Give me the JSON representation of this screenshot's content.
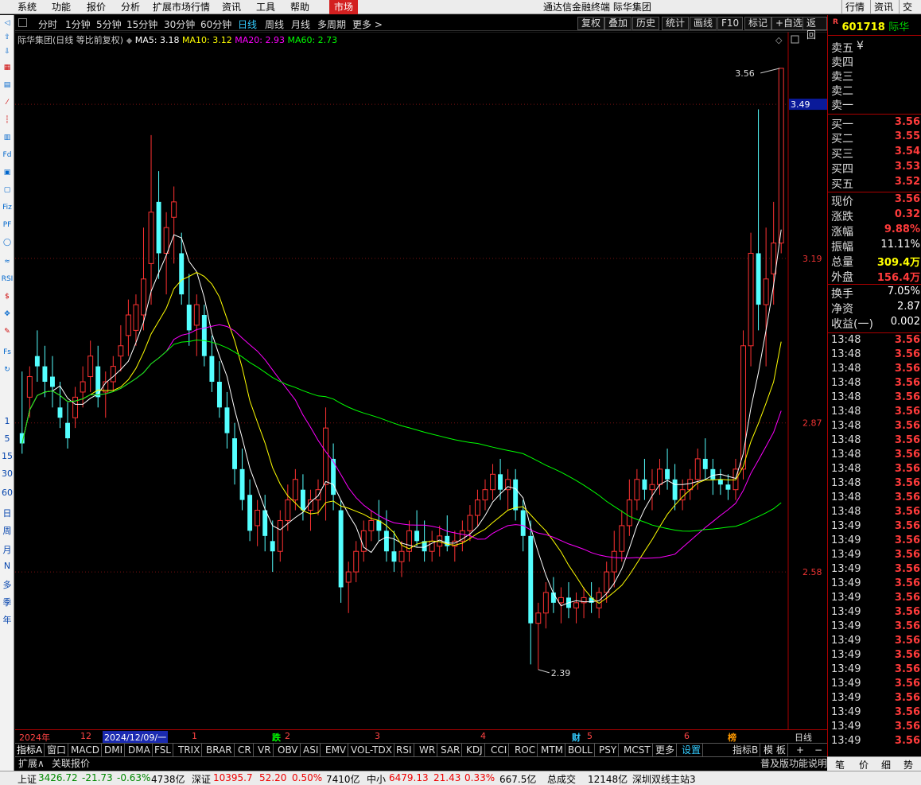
{
  "menu": {
    "items": [
      "系统",
      "功能",
      "报价",
      "分析",
      "扩展市场行情",
      "资讯",
      "工具",
      "帮助"
    ],
    "active": "市场",
    "window_title": "通达信金融终端 际华集团",
    "right": [
      "行情",
      "资讯",
      "交易"
    ]
  },
  "left_toolbar": {
    "periods": [
      "1",
      "5",
      "15",
      "30",
      "60",
      "日",
      "周",
      "月",
      "N",
      "多",
      "季",
      "年"
    ]
  },
  "periods": {
    "items": [
      "分时",
      "1分钟",
      "5分钟",
      "15分钟",
      "30分钟",
      "60分钟",
      "日线",
      "周线",
      "月线",
      "多周期",
      "更多 >"
    ],
    "selected": "日线",
    "buttons": [
      "复权",
      "叠加",
      "历史",
      "统计",
      "画线",
      "F10",
      "标记",
      "+自选",
      "返回"
    ]
  },
  "legend": {
    "title": "际华集团(日线 等比前复权)",
    "ma5": "MA5: 3.18",
    "ma10": "MA10: 3.12",
    "ma20": "MA20: 2.93",
    "ma60": "MA60: 2.73"
  },
  "chart_data": {
    "type": "candlestick",
    "ylim": [
      2.3,
      3.6
    ],
    "y_ticks": [
      "3.19",
      "2.87",
      "2.58"
    ],
    "current_price_label": "3.49",
    "high_label": "3.56",
    "low_label": "2.39",
    "x_labels": [
      "2024年",
      "12",
      "2024/12/09/一",
      "1",
      "2",
      "3",
      "4",
      "5",
      "6",
      "日线"
    ],
    "event_markers": [
      "跌",
      "财",
      "榜"
    ],
    "ma_colors": {
      "ma5": "#ffffff",
      "ma10": "#ffff00",
      "ma20": "#ff00ff",
      "ma60": "#00ff00"
    },
    "candles": [
      [
        2.85,
        2.97,
        2.81,
        2.83
      ],
      [
        2.92,
        2.98,
        2.88,
        2.96
      ],
      [
        3.0,
        3.05,
        2.95,
        2.98
      ],
      [
        2.98,
        3.02,
        2.92,
        2.95
      ],
      [
        2.96,
        3.0,
        2.9,
        2.94
      ],
      [
        2.9,
        2.95,
        2.86,
        2.88
      ],
      [
        2.87,
        2.91,
        2.82,
        2.84
      ],
      [
        2.88,
        2.94,
        2.86,
        2.92
      ],
      [
        2.93,
        2.98,
        2.9,
        2.95
      ],
      [
        2.96,
        3.03,
        2.93,
        3.0
      ],
      [
        2.98,
        3.02,
        2.9,
        2.92
      ],
      [
        2.93,
        2.97,
        2.88,
        2.95
      ],
      [
        2.95,
        3.0,
        2.93,
        2.98
      ],
      [
        3.0,
        3.06,
        2.97,
        3.02
      ],
      [
        3.04,
        3.11,
        3.0,
        3.08
      ],
      [
        3.05,
        3.12,
        3.02,
        3.1
      ],
      [
        3.08,
        3.25,
        3.05,
        3.15
      ],
      [
        3.18,
        3.43,
        3.1,
        3.28
      ],
      [
        3.3,
        3.36,
        3.15,
        3.2
      ],
      [
        3.2,
        3.28,
        3.12,
        3.25
      ],
      [
        3.27,
        3.33,
        3.18,
        3.3
      ],
      [
        3.2,
        3.24,
        3.1,
        3.12
      ],
      [
        3.1,
        3.16,
        3.02,
        3.05
      ],
      [
        3.06,
        3.12,
        3.0,
        3.1
      ],
      [
        3.08,
        3.1,
        2.98,
        3.0
      ],
      [
        3.0,
        3.04,
        2.93,
        2.95
      ],
      [
        2.95,
        2.99,
        2.88,
        2.9
      ],
      [
        2.9,
        2.93,
        2.82,
        2.85
      ],
      [
        2.84,
        2.87,
        2.75,
        2.78
      ],
      [
        2.78,
        2.82,
        2.7,
        2.72
      ],
      [
        2.73,
        2.76,
        2.64,
        2.66
      ],
      [
        2.67,
        2.72,
        2.63,
        2.7
      ],
      [
        2.7,
        2.73,
        2.62,
        2.65
      ],
      [
        2.64,
        2.68,
        2.58,
        2.62
      ],
      [
        2.62,
        2.7,
        2.6,
        2.68
      ],
      [
        2.68,
        2.75,
        2.66,
        2.72
      ],
      [
        2.72,
        2.78,
        2.7,
        2.76
      ],
      [
        2.74,
        2.77,
        2.68,
        2.7
      ],
      [
        2.7,
        2.74,
        2.66,
        2.72
      ],
      [
        2.72,
        2.76,
        2.69,
        2.74
      ],
      [
        2.75,
        2.9,
        2.68,
        2.86
      ],
      [
        2.8,
        2.83,
        2.7,
        2.73
      ],
      [
        2.7,
        2.72,
        2.52,
        2.55
      ],
      [
        2.56,
        2.6,
        2.5,
        2.58
      ],
      [
        2.58,
        2.64,
        2.56,
        2.62
      ],
      [
        2.62,
        2.68,
        2.6,
        2.66
      ],
      [
        2.66,
        2.7,
        2.64,
        2.68
      ],
      [
        2.68,
        2.72,
        2.64,
        2.66
      ],
      [
        2.66,
        2.7,
        2.6,
        2.62
      ],
      [
        2.62,
        2.66,
        2.58,
        2.6
      ],
      [
        2.6,
        2.64,
        2.57,
        2.62
      ],
      [
        2.62,
        2.68,
        2.6,
        2.66
      ],
      [
        2.66,
        2.7,
        2.63,
        2.64
      ],
      [
        2.64,
        2.68,
        2.6,
        2.62
      ],
      [
        2.62,
        2.66,
        2.6,
        2.64
      ],
      [
        2.63,
        2.67,
        2.61,
        2.65
      ],
      [
        2.65,
        2.69,
        2.62,
        2.63
      ],
      [
        2.63,
        2.66,
        2.6,
        2.64
      ],
      [
        2.64,
        2.68,
        2.62,
        2.66
      ],
      [
        2.66,
        2.71,
        2.64,
        2.69
      ],
      [
        2.69,
        2.74,
        2.67,
        2.72
      ],
      [
        2.72,
        2.76,
        2.7,
        2.74
      ],
      [
        2.74,
        2.79,
        2.72,
        2.77
      ],
      [
        2.77,
        2.8,
        2.72,
        2.74
      ],
      [
        2.74,
        2.78,
        2.7,
        2.76
      ],
      [
        2.76,
        2.78,
        2.68,
        2.7
      ],
      [
        2.7,
        2.72,
        2.62,
        2.65
      ],
      [
        2.65,
        2.68,
        2.4,
        2.48
      ],
      [
        2.48,
        2.52,
        2.39,
        2.5
      ],
      [
        2.5,
        2.56,
        2.47,
        2.54
      ],
      [
        2.54,
        2.57,
        2.5,
        2.52
      ],
      [
        2.52,
        2.55,
        2.48,
        2.53
      ],
      [
        2.53,
        2.56,
        2.49,
        2.51
      ],
      [
        2.51,
        2.54,
        2.48,
        2.52
      ],
      [
        2.52,
        2.55,
        2.49,
        2.53
      ],
      [
        2.53,
        2.56,
        2.5,
        2.52
      ],
      [
        2.51,
        2.55,
        2.49,
        2.54
      ],
      [
        2.54,
        2.6,
        2.52,
        2.58
      ],
      [
        2.58,
        2.66,
        2.55,
        2.62
      ],
      [
        2.62,
        2.7,
        2.6,
        2.67
      ],
      [
        2.67,
        2.76,
        2.65,
        2.72
      ],
      [
        2.72,
        2.78,
        2.7,
        2.76
      ],
      [
        2.76,
        2.8,
        2.72,
        2.74
      ],
      [
        2.74,
        2.78,
        2.7,
        2.75
      ],
      [
        2.75,
        2.8,
        2.73,
        2.78
      ],
      [
        2.78,
        2.82,
        2.74,
        2.76
      ],
      [
        2.76,
        2.79,
        2.7,
        2.72
      ],
      [
        2.72,
        2.76,
        2.7,
        2.74
      ],
      [
        2.74,
        2.78,
        2.72,
        2.76
      ],
      [
        2.76,
        2.82,
        2.74,
        2.8
      ],
      [
        2.8,
        2.84,
        2.76,
        2.78
      ],
      [
        2.78,
        2.8,
        2.73,
        2.76
      ],
      [
        2.76,
        2.78,
        2.73,
        2.75
      ],
      [
        2.75,
        2.77,
        2.72,
        2.74
      ],
      [
        2.74,
        2.8,
        2.72,
        2.78
      ],
      [
        2.78,
        3.05,
        2.76,
        3.02
      ],
      [
        3.02,
        3.24,
        2.98,
        3.2
      ],
      [
        3.2,
        3.48,
        3.05,
        3.1
      ],
      [
        3.1,
        3.25,
        2.98,
        3.15
      ],
      [
        3.16,
        3.3,
        3.1,
        3.22
      ],
      [
        3.22,
        3.56,
        3.2,
        3.56
      ]
    ]
  },
  "indicators": {
    "items": [
      "指标A",
      "窗口",
      "MACD",
      "DMI",
      "DMA",
      "FSL",
      "TRIX",
      "BRAR",
      "CR",
      "VR",
      "OBV",
      "ASI",
      "EMV",
      "VOL-TDX",
      "RSI",
      "WR",
      "SAR",
      "KDJ",
      "CCI",
      "ROC",
      "MTM",
      "BOLL",
      "PSY",
      "MCST",
      "更多",
      "设置"
    ],
    "right": [
      "指标B",
      "模 板",
      "+",
      "−"
    ]
  },
  "extbar": {
    "left": [
      "扩展∧",
      "关联报价"
    ],
    "right": "普及版功能说明"
  },
  "status": {
    "sh": {
      "name": "上证",
      "value": "3426.72",
      "chg": "-21.73",
      "pct": "-0.63%",
      "amt": "4738亿"
    },
    "sz": {
      "name": "深证",
      "value": "10395.7",
      "chg": "52.20",
      "pct": "0.50%",
      "amt": "7410亿"
    },
    "zx": {
      "name": "中小",
      "value": "6479.13",
      "chg": "21.43",
      "pct": "0.33%",
      "amt": "667.5亿"
    },
    "total": {
      "label": "总成交",
      "amt": "12148亿"
    },
    "site": "深圳双线主站3"
  },
  "right_panel": {
    "code": "601718",
    "name": "际华",
    "tag": "R",
    "sells": [
      "卖五",
      "卖四",
      "卖三",
      "卖二",
      "卖一"
    ],
    "sell_unit": "¥",
    "buys": [
      {
        "l": "买一",
        "v": "3.56"
      },
      {
        "l": "买二",
        "v": "3.55"
      },
      {
        "l": "买三",
        "v": "3.54"
      },
      {
        "l": "买四",
        "v": "3.53"
      },
      {
        "l": "买五",
        "v": "3.52"
      }
    ],
    "stats": [
      {
        "l": "现价",
        "v": "3.56",
        "c": "r"
      },
      {
        "l": "涨跌",
        "v": "0.32",
        "c": "r"
      },
      {
        "l": "涨幅",
        "v": "9.88%",
        "c": "r"
      },
      {
        "l": "振幅",
        "v": "11.11%",
        "c": "w"
      },
      {
        "l": "总量",
        "v": "309.4万",
        "c": "y"
      },
      {
        "l": "外盘",
        "v": "156.4万",
        "c": "r"
      }
    ],
    "stats2": [
      {
        "l": "换手",
        "v": "7.05%",
        "c": "w"
      },
      {
        "l": "净资",
        "v": "2.87",
        "c": "w"
      },
      {
        "l": "收益(一)",
        "v": "0.002",
        "c": "w"
      }
    ],
    "ticks": [
      {
        "t": "13:48",
        "p": "3.56"
      },
      {
        "t": "13:48",
        "p": "3.56"
      },
      {
        "t": "13:48",
        "p": "3.56"
      },
      {
        "t": "13:48",
        "p": "3.56"
      },
      {
        "t": "13:48",
        "p": "3.56"
      },
      {
        "t": "13:48",
        "p": "3.56"
      },
      {
        "t": "13:48",
        "p": "3.56"
      },
      {
        "t": "13:48",
        "p": "3.56"
      },
      {
        "t": "13:48",
        "p": "3.56"
      },
      {
        "t": "13:48",
        "p": "3.56"
      },
      {
        "t": "13:48",
        "p": "3.56"
      },
      {
        "t": "13:48",
        "p": "3.56"
      },
      {
        "t": "13:48",
        "p": "3.56"
      },
      {
        "t": "13:49",
        "p": "3.56"
      },
      {
        "t": "13:49",
        "p": "3.56"
      },
      {
        "t": "13:49",
        "p": "3.56"
      },
      {
        "t": "13:49",
        "p": "3.56"
      },
      {
        "t": "13:49",
        "p": "3.56"
      },
      {
        "t": "13:49",
        "p": "3.56"
      },
      {
        "t": "13:49",
        "p": "3.56"
      },
      {
        "t": "13:49",
        "p": "3.56"
      },
      {
        "t": "13:49",
        "p": "3.56"
      },
      {
        "t": "13:49",
        "p": "3.56"
      },
      {
        "t": "13:49",
        "p": "3.56"
      },
      {
        "t": "13:49",
        "p": "3.56"
      },
      {
        "t": "13:49",
        "p": "3.56"
      },
      {
        "t": "13:49",
        "p": "3.56"
      },
      {
        "t": "13:49",
        "p": "3.56"
      },
      {
        "t": "13:49",
        "p": "3.56"
      }
    ],
    "bottom": [
      "笔",
      "价",
      "细",
      "势"
    ]
  }
}
